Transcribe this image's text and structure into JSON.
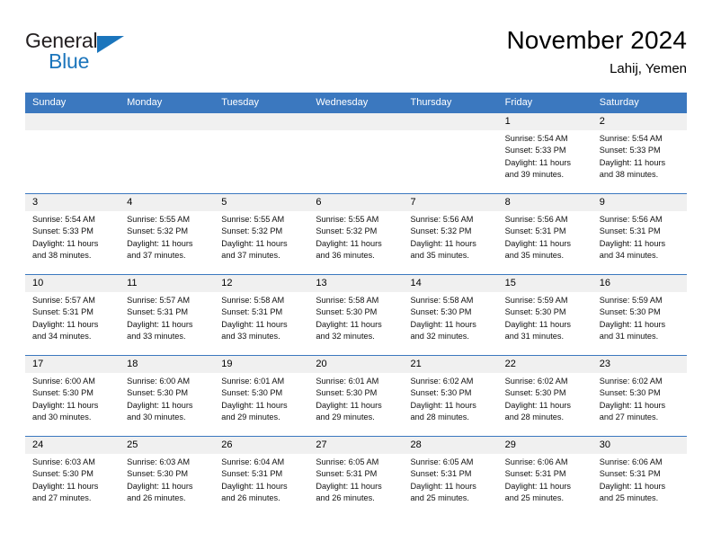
{
  "brand": {
    "name_part1": "General",
    "name_part2": "Blue",
    "triangle_color": "#1b75bc",
    "text_color": "#231f20"
  },
  "header": {
    "month_title": "November 2024",
    "location": "Lahij, Yemen"
  },
  "colors": {
    "header_bar": "#3b78bf",
    "daynum_band": "#f0f0f0",
    "row_divider": "#3b78bf",
    "page_background": "#ffffff"
  },
  "calendar": {
    "weekdays": [
      "Sunday",
      "Monday",
      "Tuesday",
      "Wednesday",
      "Thursday",
      "Friday",
      "Saturday"
    ],
    "weeks": [
      [
        {
          "day": "",
          "info": ""
        },
        {
          "day": "",
          "info": ""
        },
        {
          "day": "",
          "info": ""
        },
        {
          "day": "",
          "info": ""
        },
        {
          "day": "",
          "info": ""
        },
        {
          "day": "1",
          "info": "Sunrise: 5:54 AM\nSunset: 5:33 PM\nDaylight: 11 hours\nand 39 minutes."
        },
        {
          "day": "2",
          "info": "Sunrise: 5:54 AM\nSunset: 5:33 PM\nDaylight: 11 hours\nand 38 minutes."
        }
      ],
      [
        {
          "day": "3",
          "info": "Sunrise: 5:54 AM\nSunset: 5:33 PM\nDaylight: 11 hours\nand 38 minutes."
        },
        {
          "day": "4",
          "info": "Sunrise: 5:55 AM\nSunset: 5:32 PM\nDaylight: 11 hours\nand 37 minutes."
        },
        {
          "day": "5",
          "info": "Sunrise: 5:55 AM\nSunset: 5:32 PM\nDaylight: 11 hours\nand 37 minutes."
        },
        {
          "day": "6",
          "info": "Sunrise: 5:55 AM\nSunset: 5:32 PM\nDaylight: 11 hours\nand 36 minutes."
        },
        {
          "day": "7",
          "info": "Sunrise: 5:56 AM\nSunset: 5:32 PM\nDaylight: 11 hours\nand 35 minutes."
        },
        {
          "day": "8",
          "info": "Sunrise: 5:56 AM\nSunset: 5:31 PM\nDaylight: 11 hours\nand 35 minutes."
        },
        {
          "day": "9",
          "info": "Sunrise: 5:56 AM\nSunset: 5:31 PM\nDaylight: 11 hours\nand 34 minutes."
        }
      ],
      [
        {
          "day": "10",
          "info": "Sunrise: 5:57 AM\nSunset: 5:31 PM\nDaylight: 11 hours\nand 34 minutes."
        },
        {
          "day": "11",
          "info": "Sunrise: 5:57 AM\nSunset: 5:31 PM\nDaylight: 11 hours\nand 33 minutes."
        },
        {
          "day": "12",
          "info": "Sunrise: 5:58 AM\nSunset: 5:31 PM\nDaylight: 11 hours\nand 33 minutes."
        },
        {
          "day": "13",
          "info": "Sunrise: 5:58 AM\nSunset: 5:30 PM\nDaylight: 11 hours\nand 32 minutes."
        },
        {
          "day": "14",
          "info": "Sunrise: 5:58 AM\nSunset: 5:30 PM\nDaylight: 11 hours\nand 32 minutes."
        },
        {
          "day": "15",
          "info": "Sunrise: 5:59 AM\nSunset: 5:30 PM\nDaylight: 11 hours\nand 31 minutes."
        },
        {
          "day": "16",
          "info": "Sunrise: 5:59 AM\nSunset: 5:30 PM\nDaylight: 11 hours\nand 31 minutes."
        }
      ],
      [
        {
          "day": "17",
          "info": "Sunrise: 6:00 AM\nSunset: 5:30 PM\nDaylight: 11 hours\nand 30 minutes."
        },
        {
          "day": "18",
          "info": "Sunrise: 6:00 AM\nSunset: 5:30 PM\nDaylight: 11 hours\nand 30 minutes."
        },
        {
          "day": "19",
          "info": "Sunrise: 6:01 AM\nSunset: 5:30 PM\nDaylight: 11 hours\nand 29 minutes."
        },
        {
          "day": "20",
          "info": "Sunrise: 6:01 AM\nSunset: 5:30 PM\nDaylight: 11 hours\nand 29 minutes."
        },
        {
          "day": "21",
          "info": "Sunrise: 6:02 AM\nSunset: 5:30 PM\nDaylight: 11 hours\nand 28 minutes."
        },
        {
          "day": "22",
          "info": "Sunrise: 6:02 AM\nSunset: 5:30 PM\nDaylight: 11 hours\nand 28 minutes."
        },
        {
          "day": "23",
          "info": "Sunrise: 6:02 AM\nSunset: 5:30 PM\nDaylight: 11 hours\nand 27 minutes."
        }
      ],
      [
        {
          "day": "24",
          "info": "Sunrise: 6:03 AM\nSunset: 5:30 PM\nDaylight: 11 hours\nand 27 minutes."
        },
        {
          "day": "25",
          "info": "Sunrise: 6:03 AM\nSunset: 5:30 PM\nDaylight: 11 hours\nand 26 minutes."
        },
        {
          "day": "26",
          "info": "Sunrise: 6:04 AM\nSunset: 5:31 PM\nDaylight: 11 hours\nand 26 minutes."
        },
        {
          "day": "27",
          "info": "Sunrise: 6:05 AM\nSunset: 5:31 PM\nDaylight: 11 hours\nand 26 minutes."
        },
        {
          "day": "28",
          "info": "Sunrise: 6:05 AM\nSunset: 5:31 PM\nDaylight: 11 hours\nand 25 minutes."
        },
        {
          "day": "29",
          "info": "Sunrise: 6:06 AM\nSunset: 5:31 PM\nDaylight: 11 hours\nand 25 minutes."
        },
        {
          "day": "30",
          "info": "Sunrise: 6:06 AM\nSunset: 5:31 PM\nDaylight: 11 hours\nand 25 minutes."
        }
      ]
    ]
  }
}
